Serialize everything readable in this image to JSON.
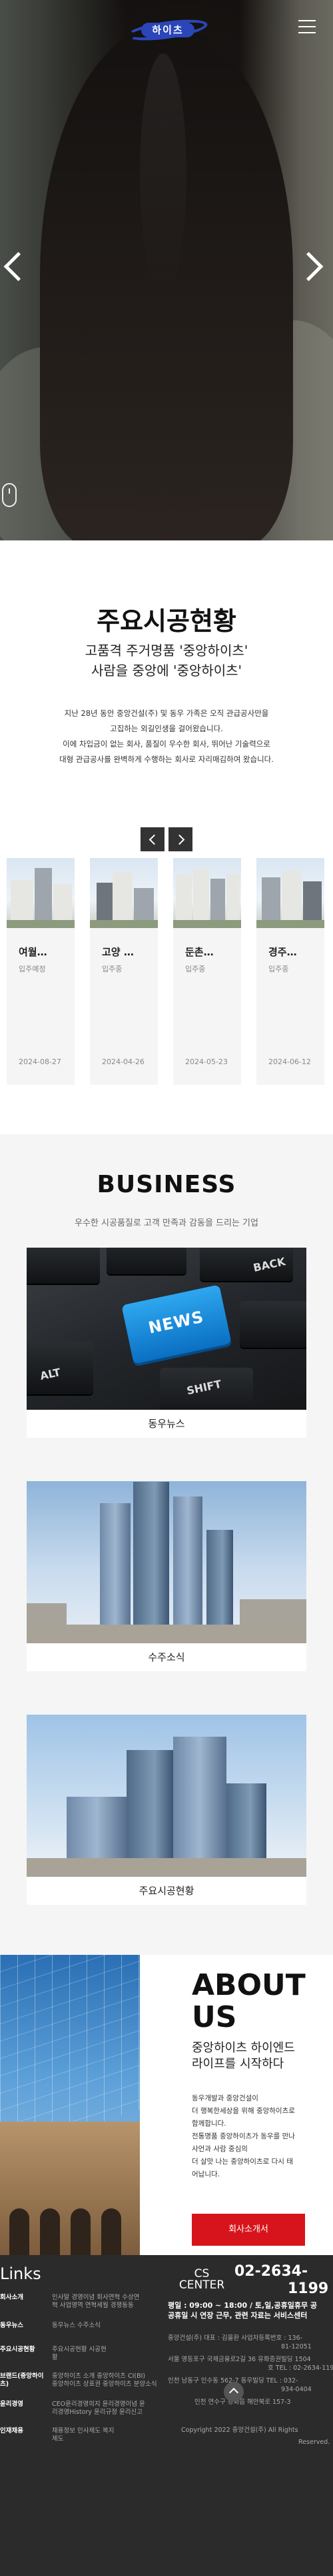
{
  "header": {
    "logo_text": "하이츠",
    "menu_icon": "hamburger-menu-icon",
    "brand_color": "#2b46b9"
  },
  "hero": {
    "prev_icon": "chevron-left-icon",
    "next_icon": "chevron-right-icon",
    "scroll_icon": "scroll-mouse-icon"
  },
  "cases": {
    "title": "주요시공현황",
    "subtitle_line1": "고품격 주거명품 '중앙하이츠'",
    "subtitle_line2": "사람을 중앙에 '중앙하이츠'",
    "desc_line1": "지난 28년 동안 중앙건설(주) 및 동우 가족은 오직 관급공사만을",
    "desc_line2": "고집하는 외길인생을 걸어왔습니다.",
    "desc_line3": "이에 차입금이 없는 회사, 품질이 우수한 회사, 뛰어난 기술력으로",
    "desc_line4": "대형 관급공사를 완벽하게 수행하는 회사로 자리매김하여 왔습니다.",
    "items": [
      {
        "name": "여월…",
        "status": "입주예정",
        "date": "2024-08-27"
      },
      {
        "name": "고양 …",
        "status": "입주중",
        "date": "2024-04-26"
      },
      {
        "name": "둔촌…",
        "status": "입주중",
        "date": "2024-05-23"
      },
      {
        "name": "경주…",
        "status": "입주중",
        "date": "2024-06-12"
      }
    ]
  },
  "business": {
    "title": "BUSINESS",
    "subtitle": "우수한 시공품질로 고객 만족과 감동을 드리는 기업",
    "items": [
      {
        "label": "동우뉴스",
        "key_news": "NEWS",
        "key_back": "BACK",
        "key_alt": "ALT",
        "key_shift": "SHIFT"
      },
      {
        "label": "수주소식"
      },
      {
        "label": "주요시공현황"
      }
    ]
  },
  "about": {
    "title_line1": "ABOUT",
    "title_line2": "US",
    "subtitle_line1": "중앙하이츠 하이엔드",
    "subtitle_line2": "라이프를 시작하다",
    "desc_line1": "동우개발과 중앙건설이",
    "desc_line2": "더 행복한세상을 위해 중앙하이츠로",
    "desc_line3": "함께합니다.",
    "desc_line4": "전통명품 중앙하이츠가 동우를 만나",
    "desc_line5": "사언과 사람 중심의",
    "desc_line6": "더 살맛 나는 중앙하이츠로 다시 태",
    "desc_line7": "어납니다.",
    "button_label": "회사소개서",
    "button_color": "#d7141b"
  },
  "footer": {
    "links_title": "Links",
    "links": [
      {
        "head": "회사소개",
        "body_line1": "인사말 경영이념 회사연혁 수상연",
        "body_line2": "혁 사업영역 연혁세월 경쟁동동"
      },
      {
        "head": "동우뉴스",
        "body_line1": "동우뉴스 수주소식",
        "body_line2": ""
      },
      {
        "head": "주요시공현황",
        "body_line1": "주요시공현황 시공현",
        "body_line2": "황"
      },
      {
        "head": "브랜드(중앙하이츠)",
        "body_line1": "중앙하이츠 소개 중앙하이츠 CI(BI)",
        "body_line2": "중앙하이츠 상표권 중앙하이츠 분양소식"
      },
      {
        "head": "윤리경영",
        "body_line1": "CEO윤리경영의지 윤리경영이념 윤",
        "body_line2": "리경영History 윤리규정 윤리신고"
      },
      {
        "head": "인재채용",
        "body_line1": "채용정보 인사제도 복지",
        "body_line2": "제도"
      }
    ],
    "cs_label_line1": "CS",
    "cs_label_line2": "CENTER",
    "cs_phone_line1": "02-2634-",
    "cs_phone_line2": "1199",
    "hours_line1": "평일 : 09:00 ~ 18:00 / 토,일,공휴일휴무 공",
    "hours_line2": "공휴일 시 연장 근무, 관련 자료는 서비스센터",
    "address_line1": "중앙건설(주) 대표 : 김을환 사업자등록번호 : 136-",
    "address_line2": "81-12051",
    "address_line3": "서울 영등포구 국제금융로2길 36 유화증권빌딩 1504",
    "address_line4": "호 TEL : 02-2634-1199",
    "address_line5": "인천 남동구 인수동 562-7 동우빌딩 TEL : 032-",
    "address_line6": "934-0404",
    "address_line7": "인천 연수구 강화읍 해안북로 157-3",
    "copyright_line1": "Copyright 2022 중앙건설(주) All Rights",
    "copyright_line2": "Reserved.",
    "top_icon": "scroll-top-icon"
  }
}
